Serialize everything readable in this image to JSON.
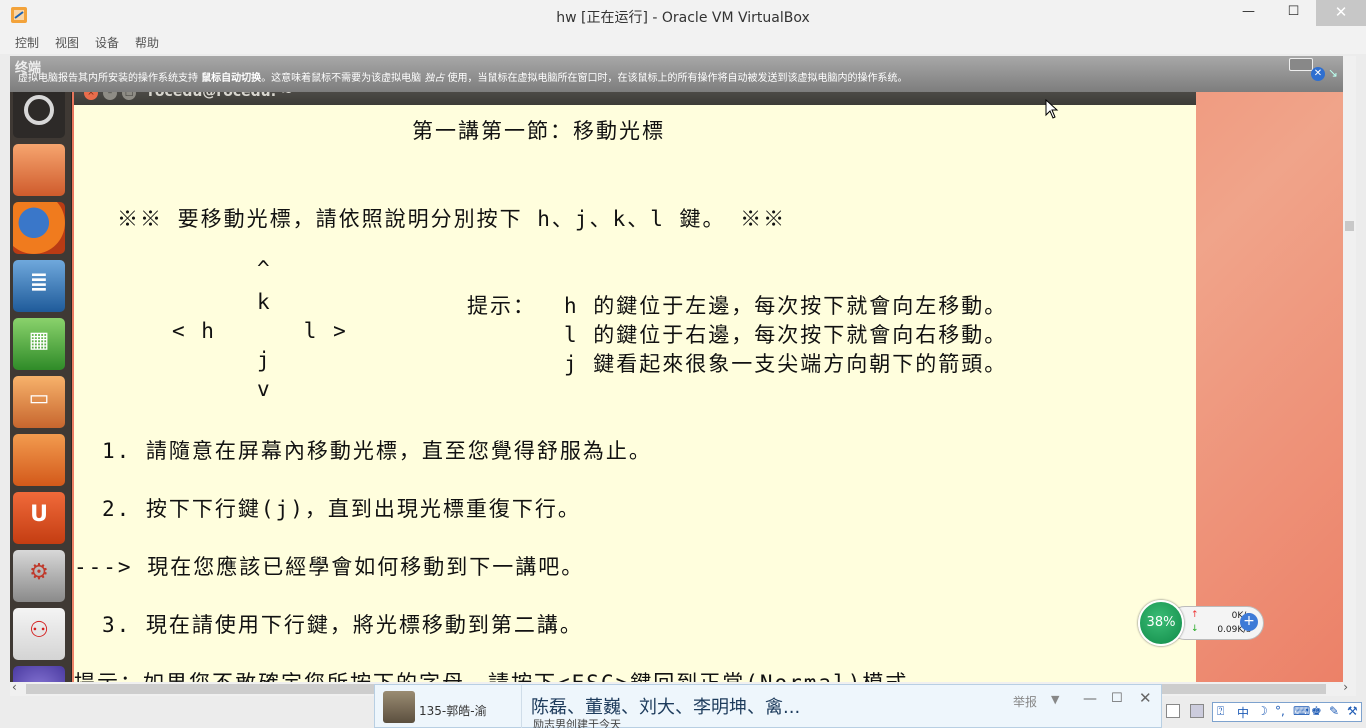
{
  "window": {
    "title": "hw [正在运行] - Oracle VM VirtualBox",
    "min_glyph": "—",
    "max_glyph": "☐",
    "close_glyph": "✕"
  },
  "menu": {
    "items": [
      "控制",
      "视图",
      "设备",
      "帮助"
    ]
  },
  "notification": {
    "title": "终端",
    "msg_part1": "虚拟电脑报告其内所安装的操作系统支持 ",
    "msg_bold": "鼠标自动切换",
    "msg_part2": "。这意味着鼠标不需要为该虚拟电脑 ",
    "msg_italic": "独占",
    "msg_part3": " 使用，当鼠标在虚拟电脑所在窗口时，在该鼠标上的所有操作将自动被发送到该虚拟电脑内的操作系统。",
    "close_glyph": "✕",
    "pin_glyph": "↘"
  },
  "launcher": {
    "items": [
      {
        "name": "dash-icon",
        "glyph": ""
      },
      {
        "name": "files-icon",
        "glyph": ""
      },
      {
        "name": "firefox-icon",
        "glyph": ""
      },
      {
        "name": "libreoffice-writer-icon",
        "glyph": "≣"
      },
      {
        "name": "libreoffice-calc-icon",
        "glyph": "▦"
      },
      {
        "name": "libreoffice-impress-icon",
        "glyph": "▭"
      },
      {
        "name": "software-center-icon",
        "glyph": ""
      },
      {
        "name": "ubuntu-one-icon",
        "glyph": "U"
      },
      {
        "name": "system-settings-icon",
        "glyph": "⚙"
      },
      {
        "name": "umbrello-icon",
        "glyph": "⚇"
      },
      {
        "name": "more-apps-icon",
        "glyph": ""
      }
    ]
  },
  "terminal": {
    "title": "rocedu@rocedu: ~",
    "close_glyph": "×",
    "min_glyph": "–",
    "max_glyph": "□",
    "lines": {
      "heading": "第一講第一節：移動光標",
      "intro": "※※ 要移動光標，請依照說明分別按下 h、j、k、l 鍵。 ※※",
      "caret": "^",
      "k_key": "k",
      "hint_label": "提示：",
      "hint_h": "h 的鍵位于左邊，每次按下就會向左移動。",
      "h_l_keys": "< h      l >",
      "hint_l": "l 的鍵位于右邊，每次按下就會向右移動。",
      "j_key": "j",
      "hint_j": "j 鍵看起來很象一支尖端方向朝下的箭頭。",
      "v_key": "v",
      "step1": "1. 請隨意在屏幕內移動光標，直至您覺得舒服為止。",
      "step2": "2. 按下下行鍵(j)，直到出現光標重復下行。",
      "arrow_line": "---> 現在您應該已經學會如何移動到下一講吧。",
      "step3": "3. 現在請使用下行鍵，將光標移動到第二講。",
      "tip": "提示：如果您不敢確定您所按下的字母，請按下<ESC>鍵回到正常(Normal)模式。"
    }
  },
  "netmon": {
    "percent": "38%",
    "up": "0K/s",
    "down": "0.09K/s",
    "up_glyph": "↑",
    "down_glyph": "↓",
    "plus_glyph": "+"
  },
  "chat": {
    "contact": "135-郭皓-渝",
    "message": "陈磊、董巍、刘大、李明坤、禽...",
    "sub": "励志男创建于今天",
    "report": "举报",
    "dropdown_glyph": "▼",
    "min_glyph": "—",
    "max_glyph": "☐",
    "close_glyph": "✕"
  },
  "ime": {
    "items": [
      "⍰",
      "中",
      "☽",
      "°,",
      "⌨",
      "♚",
      "✎",
      "⚒"
    ]
  },
  "scroll": {
    "left_glyph": "‹",
    "right_glyph": "›"
  }
}
